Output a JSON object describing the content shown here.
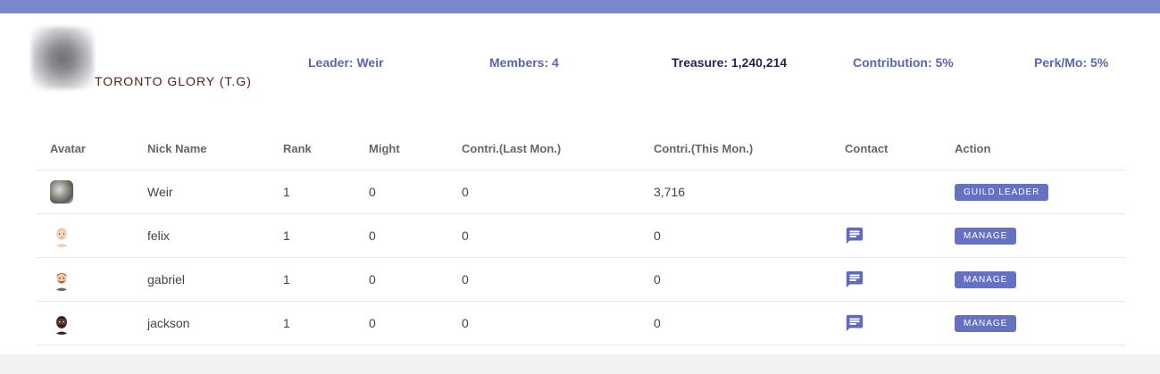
{
  "guild": {
    "name": "TORONTO GLORY (T.G)",
    "leader": "Leader: Weir",
    "members": "Members: 4",
    "treasure": "Treasure: 1,240,214",
    "contribution": "Contribution: 5%",
    "perk": "Perk/Mo: 5%"
  },
  "table": {
    "headers": {
      "avatar": "Avatar",
      "nick": "Nick Name",
      "rank": "Rank",
      "might": "Might",
      "last": "Contri.(Last Mon.)",
      "this": "Contri.(This Mon.)",
      "contact": "Contact",
      "action": "Action"
    },
    "rows": [
      {
        "nick": "Weir",
        "rank": "1",
        "might": "0",
        "last": "0",
        "this": "3,716",
        "action": "GUILD LEADER"
      },
      {
        "nick": "felix",
        "rank": "1",
        "might": "0",
        "last": "0",
        "this": "0",
        "action": "MANAGE"
      },
      {
        "nick": "gabriel",
        "rank": "1",
        "might": "0",
        "last": "0",
        "this": "0",
        "action": "MANAGE"
      },
      {
        "nick": "jackson",
        "rank": "1",
        "might": "0",
        "last": "0",
        "this": "0",
        "action": "MANAGE"
      }
    ]
  },
  "icons": {
    "contact": "chat-icon"
  },
  "colors": {
    "accent": "#6571c3",
    "top_bar": "#7a87cc",
    "guild_name": "#5a1a0e"
  }
}
